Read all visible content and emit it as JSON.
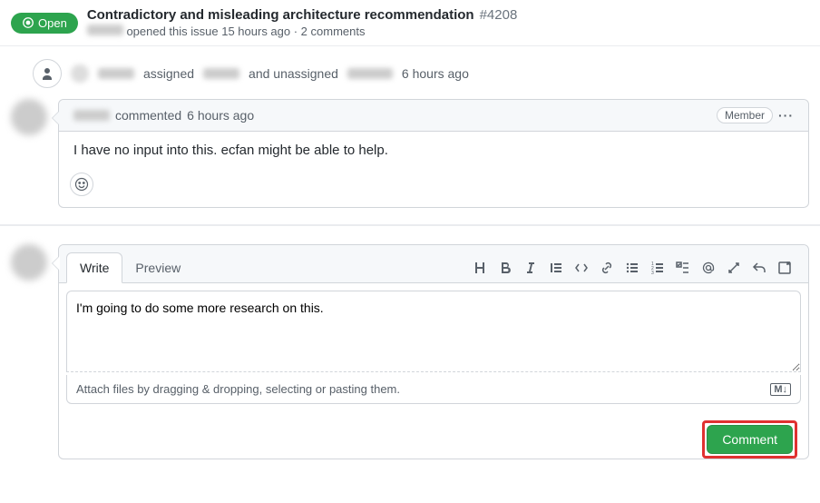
{
  "header": {
    "status": "Open",
    "title": "Contradictory and misleading architecture recommendation",
    "issue_number": "#4208",
    "subtitle_mid": "opened this issue 15 hours ago · 2 comments"
  },
  "event": {
    "assigned": "assigned",
    "and_unassigned": "and unassigned",
    "time": "6 hours ago"
  },
  "comment": {
    "commented": "commented",
    "time": "6 hours ago",
    "badge": "Member",
    "body": "I have no input into this. ecfan might be able to help."
  },
  "editor": {
    "tabs": {
      "write": "Write",
      "preview": "Preview"
    },
    "text": "I'm going to do some more research on this.",
    "attach": "Attach files by dragging & dropping, selecting or pasting them.",
    "md": "M↓"
  },
  "footer": {
    "comment": "Comment"
  }
}
